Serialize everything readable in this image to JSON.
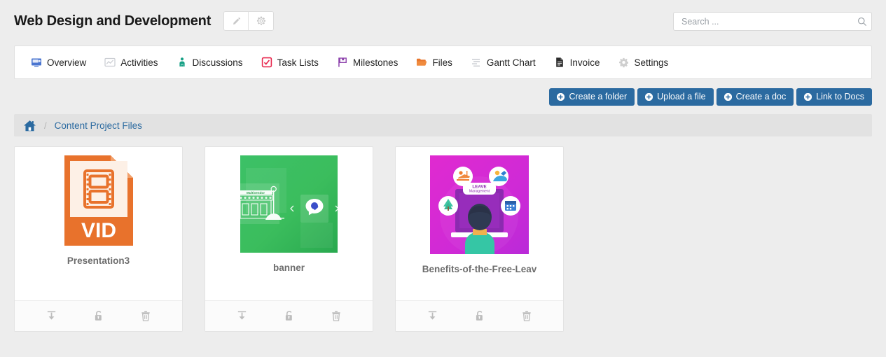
{
  "header": {
    "title": "Web Design and Development",
    "edit_icon": "pencil-icon",
    "settings_icon": "gear-icon"
  },
  "search": {
    "placeholder": "Search ...",
    "value": "",
    "icon": "search-icon"
  },
  "tabs": [
    {
      "label": "Overview",
      "icon": "monitor-icon",
      "color": "#4a75d0"
    },
    {
      "label": "Activities",
      "icon": "chart-icon",
      "color": "#c9ccd1"
    },
    {
      "label": "Discussions",
      "icon": "people-icon",
      "color": "#16a085"
    },
    {
      "label": "Task Lists",
      "icon": "checkbox-icon",
      "color": "#e8294f"
    },
    {
      "label": "Milestones",
      "icon": "flag-icon",
      "color": "#8e44ad"
    },
    {
      "label": "Files",
      "icon": "folder-icon",
      "color": "#e8772e"
    },
    {
      "label": "Gantt Chart",
      "icon": "bars-icon",
      "color": "#c9ccd1"
    },
    {
      "label": "Invoice",
      "icon": "document-icon",
      "color": "#2c2c2c"
    },
    {
      "label": "Settings",
      "icon": "gear-icon",
      "color": "#cfcfcf"
    }
  ],
  "actions": [
    {
      "label": "Create a folder",
      "icon": "plus-circle-icon"
    },
    {
      "label": "Upload a file",
      "icon": "plus-circle-icon"
    },
    {
      "label": "Create a doc",
      "icon": "plus-circle-icon"
    },
    {
      "label": "Link to Docs",
      "icon": "plus-circle-icon"
    }
  ],
  "breadcrumb": {
    "home_icon": "home-icon",
    "separator": "/",
    "current": "Content Project Files"
  },
  "files": [
    {
      "name": "Presentation3",
      "thumb_type": "file-type-icon",
      "file_type_label": "VID",
      "accent": "#e8722c",
      "actions": [
        {
          "name": "download-icon",
          "title": "Download"
        },
        {
          "name": "lock-icon",
          "title": "Lock"
        },
        {
          "name": "trash-icon",
          "title": "Delete"
        }
      ]
    },
    {
      "name": "banner",
      "thumb_type": "image-preview",
      "caption": "Multivendor",
      "accent": "#3cba5a",
      "actions": [
        {
          "name": "download-icon",
          "title": "Download"
        },
        {
          "name": "lock-icon",
          "title": "Lock"
        },
        {
          "name": "trash-icon",
          "title": "Delete"
        }
      ]
    },
    {
      "name": "Benefits-of-the-Free-Leav",
      "thumb_type": "image-preview",
      "caption_line1": "LEAVE",
      "caption_line2": "Management",
      "accent": "#d22ad2",
      "actions": [
        {
          "name": "download-icon",
          "title": "Download"
        },
        {
          "name": "lock-icon",
          "title": "Lock"
        },
        {
          "name": "trash-icon",
          "title": "Delete"
        }
      ]
    }
  ],
  "theme": {
    "primary": "#2b6aa0",
    "page_bg": "#ededed",
    "link": "#2b6aa0"
  }
}
